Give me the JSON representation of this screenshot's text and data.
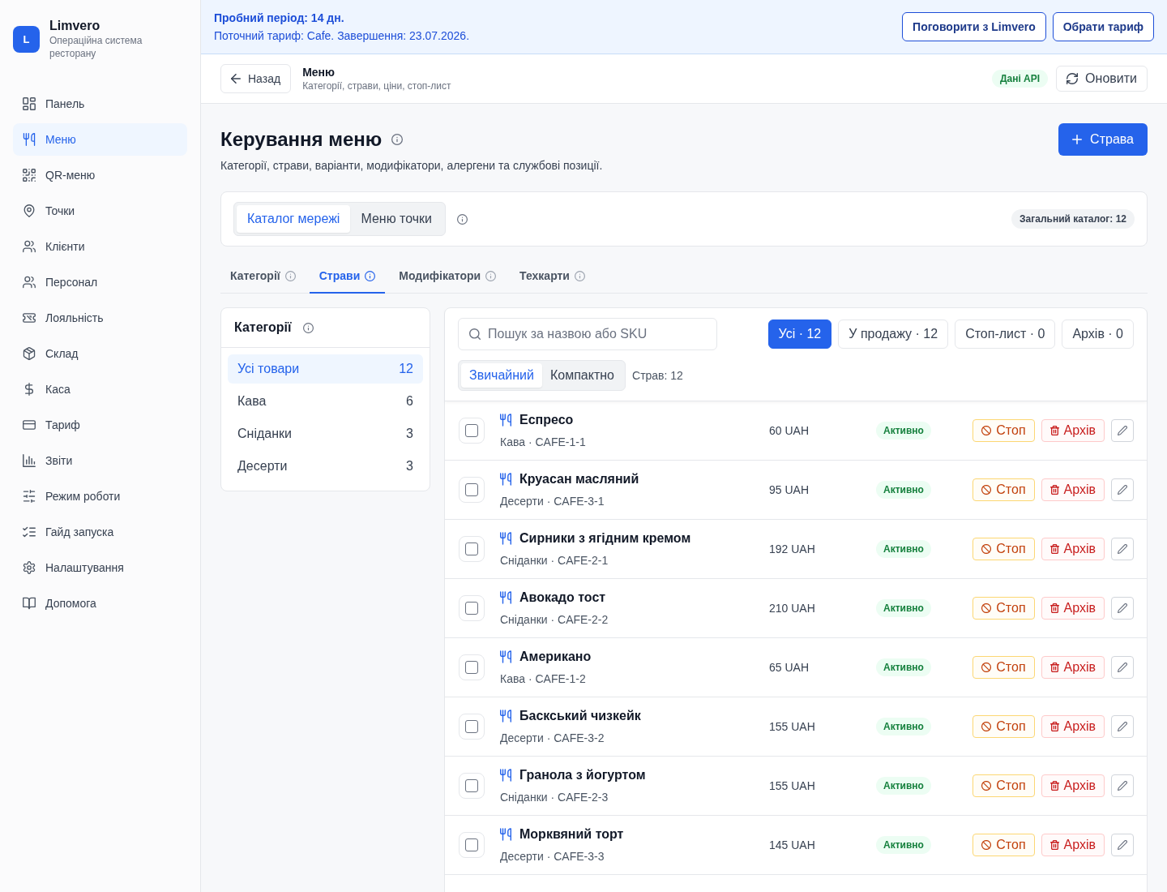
{
  "sidebar": {
    "brand": {
      "letter": "L",
      "name": "Limvero",
      "subtitle": "Операційна система ресторану"
    },
    "items": [
      {
        "label": "Панель",
        "selected": false
      },
      {
        "label": "Меню",
        "selected": true
      },
      {
        "label": "QR-меню",
        "selected": false
      },
      {
        "label": "Точки",
        "selected": false
      },
      {
        "label": "Клієнти",
        "selected": false
      },
      {
        "label": "Персонал",
        "selected": false
      },
      {
        "label": "Лояльність",
        "selected": false
      },
      {
        "label": "Склад",
        "selected": false
      },
      {
        "label": "Каса",
        "selected": false
      },
      {
        "label": "Тариф",
        "selected": false
      },
      {
        "label": "Звіти",
        "selected": false
      },
      {
        "label": "Режим роботи",
        "selected": false
      },
      {
        "label": "Гайд запуска",
        "selected": false
      },
      {
        "label": "Налаштування",
        "selected": false
      },
      {
        "label": "Допомога",
        "selected": false
      }
    ]
  },
  "banner": {
    "title": "Пробний період: 14 дн.",
    "text": "Поточний тариф: Cafe. Завершення: 23.07.2026.",
    "buttons": [
      "Поговорити з Limvero",
      "Обрати тариф"
    ]
  },
  "header": {
    "back": "Назад",
    "title": "Меню",
    "subtitle": "Категорії, страви, ціни, стоп-лист",
    "badge": "Дані API",
    "refresh": "Оновити"
  },
  "page": {
    "title": "Керування меню",
    "subtitle": "Категорії, страви, варіанти, модифікатори, алергени та службові позиції.",
    "add_button": "Страва"
  },
  "scope": {
    "options": [
      {
        "label": "Каталог мережі",
        "selected": true
      },
      {
        "label": "Меню точки",
        "selected": false
      }
    ],
    "badge": "Загальний каталог: 12"
  },
  "tabs": [
    {
      "label": "Категорії",
      "selected": false
    },
    {
      "label": "Страви",
      "selected": true
    },
    {
      "label": "Модифікатори",
      "selected": false
    },
    {
      "label": "Техкарти",
      "selected": false
    }
  ],
  "categories": {
    "title": "Категорії",
    "items": [
      {
        "label": "Усі товари",
        "count": "12",
        "selected": true
      },
      {
        "label": "Кава",
        "count": "6",
        "selected": false
      },
      {
        "label": "Сніданки",
        "count": "3",
        "selected": false
      },
      {
        "label": "Десерти",
        "count": "3",
        "selected": false
      }
    ]
  },
  "dishes": {
    "search": {
      "placeholder": "Пошук за назвою або SKU"
    },
    "filters": [
      {
        "label": "Усі · 12",
        "selected": true
      },
      {
        "label": "У продажу · 12",
        "selected": false
      },
      {
        "label": "Стоп-лист · 0",
        "selected": false
      },
      {
        "label": "Архів · 0",
        "selected": false
      }
    ],
    "view": [
      {
        "label": "Звичайний",
        "selected": true
      },
      {
        "label": "Компактно",
        "selected": false
      }
    ],
    "count": "Страв: 12",
    "items": [
      {
        "name": "Еспресо",
        "meta": "Кава · CAFE-1-1",
        "price": "60 UAH",
        "status": "Активно",
        "stop": "Стоп",
        "archive": "Архів",
        "checked": false
      },
      {
        "name": "Круасан масляний",
        "meta": "Десерти · CAFE-3-1",
        "price": "95 UAH",
        "status": "Активно",
        "stop": "Стоп",
        "archive": "Архів",
        "checked": false
      },
      {
        "name": "Сирники з ягідним кремом",
        "meta": "Сніданки · CAFE-2-1",
        "price": "192 UAH",
        "status": "Активно",
        "stop": "Стоп",
        "archive": "Архів",
        "checked": false
      },
      {
        "name": "Авокадо тост",
        "meta": "Сніданки · CAFE-2-2",
        "price": "210 UAH",
        "status": "Активно",
        "stop": "Стоп",
        "archive": "Архів",
        "checked": false
      },
      {
        "name": "Американо",
        "meta": "Кава · CAFE-1-2",
        "price": "65 UAH",
        "status": "Активно",
        "stop": "Стоп",
        "archive": "Архів",
        "checked": false
      },
      {
        "name": "Баскський чизкейк",
        "meta": "Десерти · CAFE-3-2",
        "price": "155 UAH",
        "status": "Активно",
        "stop": "Стоп",
        "archive": "Архів",
        "checked": false
      },
      {
        "name": "Гранола з йогуртом",
        "meta": "Сніданки · CAFE-2-3",
        "price": "155 UAH",
        "status": "Активно",
        "stop": "Стоп",
        "archive": "Архів",
        "checked": false
      },
      {
        "name": "Морквяний торт",
        "meta": "Десерти · CAFE-3-3",
        "price": "145 UAH",
        "status": "Активно",
        "stop": "Стоп",
        "archive": "Архів",
        "checked": false
      }
    ]
  }
}
